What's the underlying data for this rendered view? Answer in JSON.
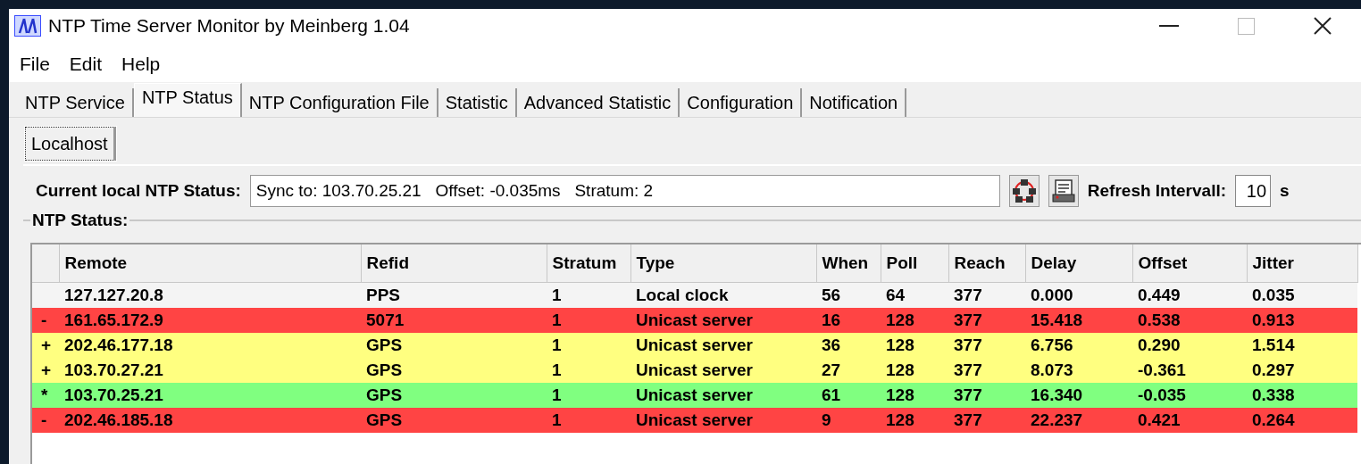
{
  "window": {
    "title": "NTP Time Server Monitor by Meinberg 1.04"
  },
  "menu": [
    "File",
    "Edit",
    "Help"
  ],
  "tabs": [
    {
      "label": "NTP Service",
      "selected": false
    },
    {
      "label": "NTP Status",
      "selected": true
    },
    {
      "label": "NTP Configuration File",
      "selected": false
    },
    {
      "label": "Statistic",
      "selected": false
    },
    {
      "label": "Advanced Statistic",
      "selected": false
    },
    {
      "label": "Configuration",
      "selected": false
    },
    {
      "label": "Notification",
      "selected": false
    }
  ],
  "host_tabs": [
    {
      "label": "Localhost",
      "selected": true
    }
  ],
  "status": {
    "label": "Current local NTP Status:",
    "value": "Sync to: 103.70.25.21   Offset: -0.035ms   Stratum: 2",
    "refresh_label": "Refresh Intervall:",
    "refresh_value": "10",
    "refresh_unit": "s"
  },
  "table": {
    "title": "NTP Status:",
    "columns": [
      "Remote",
      "Refid",
      "Stratum",
      "Type",
      "When",
      "Poll",
      "Reach",
      "Delay",
      "Offset",
      "Jitter"
    ],
    "rows": [
      {
        "color": "#f4f4f4",
        "cells": [
          "127.127.20.8",
          "PPS",
          "1",
          "Local clock",
          "56",
          "64",
          "377",
          "0.000",
          "0.449",
          "0.035"
        ]
      },
      {
        "marker": "-",
        "color": "#ff4444",
        "cells": [
          "161.65.172.9",
          "5071",
          "1",
          "Unicast server",
          "16",
          "128",
          "377",
          "15.418",
          "0.538",
          "0.913"
        ]
      },
      {
        "marker": "+",
        "color": "#ffff80",
        "cells": [
          "202.46.177.18",
          "GPS",
          "1",
          "Unicast server",
          "36",
          "128",
          "377",
          "6.756",
          "0.290",
          "1.514"
        ]
      },
      {
        "marker": "+",
        "color": "#ffff80",
        "cells": [
          "103.70.27.21",
          "GPS",
          "1",
          "Unicast server",
          "27",
          "128",
          "377",
          "8.073",
          "-0.361",
          "0.297"
        ]
      },
      {
        "marker": "*",
        "color": "#80ff80",
        "cells": [
          "103.70.25.21",
          "GPS",
          "1",
          "Unicast server",
          "61",
          "128",
          "377",
          "16.340",
          "-0.035",
          "0.338"
        ]
      },
      {
        "marker": "-",
        "color": "#ff4444",
        "cells": [
          "202.46.185.18",
          "GPS",
          "1",
          "Unicast server",
          "9",
          "128",
          "377",
          "22.237",
          "0.421",
          "0.264"
        ]
      }
    ]
  }
}
